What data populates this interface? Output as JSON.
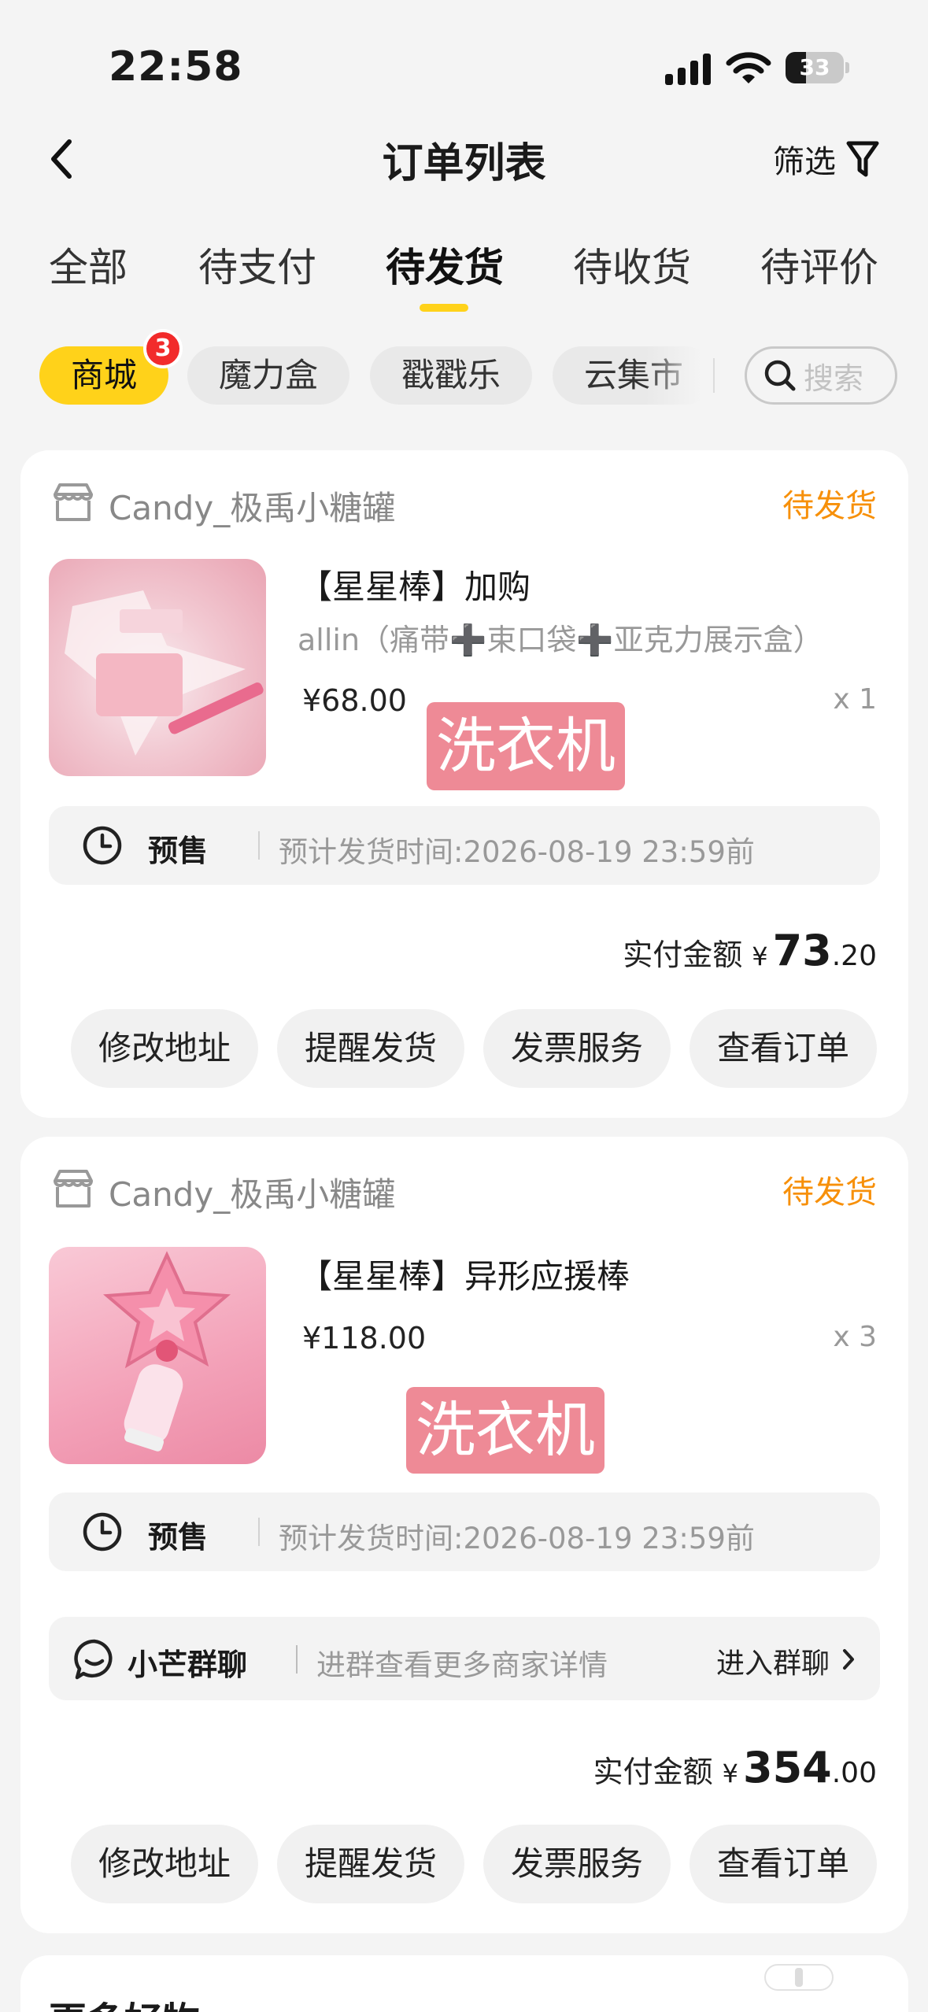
{
  "status_bar": {
    "time": "22:58",
    "battery": "33"
  },
  "header": {
    "title": "订单列表",
    "filter_label": "筛选"
  },
  "tabs": [
    "全部",
    "待支付",
    "待发货",
    "待收货",
    "待评价"
  ],
  "active_tab": "待发货",
  "chips": [
    "商城",
    "魔力盒",
    "戳戳乐",
    "云集市"
  ],
  "chip_badge": "3",
  "search": {
    "placeholder": "搜索"
  },
  "orders": [
    {
      "shop_name": "Candy_极禹小糖罐",
      "status": "待发货",
      "title": "【星星棒】加购",
      "spec": "allin（痛带➕束口袋➕亚克力展示盒）",
      "price": "¥68.00",
      "qty": "x 1",
      "sticker": "洗衣机",
      "presale_label": "预售",
      "presale_text": "预计发货时间:2026-08-19 23:59前",
      "total_label": "实付金额",
      "total_currency": "¥",
      "total_int": "73",
      "total_dec": ".20",
      "actions": [
        "修改地址",
        "提醒发货",
        "发票服务",
        "查看订单"
      ]
    },
    {
      "shop_name": "Candy_极禹小糖罐",
      "status": "待发货",
      "title": "【星星棒】异形应援棒",
      "price": "¥118.00",
      "qty": "x 3",
      "sticker": "洗衣机",
      "presale_label": "预售",
      "presale_text": "预计发货时间:2026-08-19 23:59前",
      "group_name": "小芒群聊",
      "group_desc": "进群查看更多商家详情",
      "group_enter": "进入群聊",
      "total_label": "实付金额",
      "total_currency": "¥",
      "total_int": "354",
      "total_dec": ".00",
      "actions": [
        "修改地址",
        "提醒发货",
        "发票服务",
        "查看订单"
      ]
    }
  ],
  "more_section": {
    "title": "更多好物"
  },
  "colors": {
    "accent_yellow": "#ffd21a",
    "status_orange": "#f7900a",
    "badge_red": "#f22b2b",
    "sticker_pink": "#ee8a96"
  }
}
